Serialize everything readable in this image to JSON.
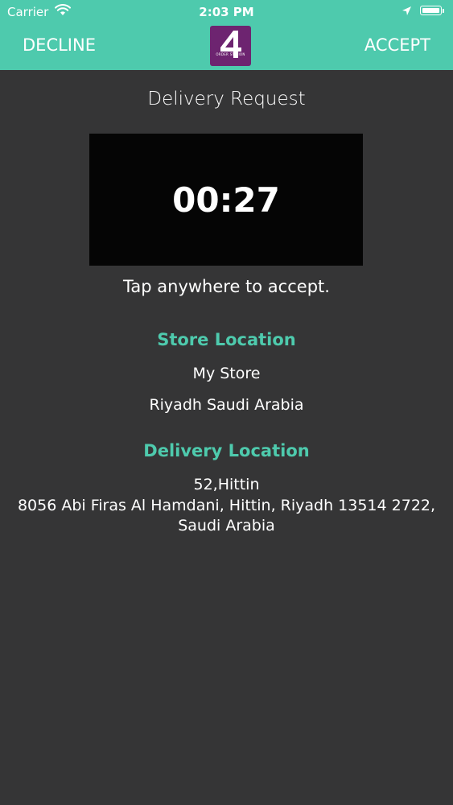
{
  "status_bar": {
    "carrier": "Carrier",
    "time": "2:03 PM",
    "wifi_icon": "wifi-icon",
    "location_icon": "location-arrow-icon",
    "battery_icon": "battery-icon",
    "battery_level": 1.0
  },
  "nav": {
    "decline_label": "DECLINE",
    "accept_label": "ACCEPT",
    "logo_text": "ORDER STATION",
    "logo_digit": "4"
  },
  "request": {
    "title": "Delivery Request",
    "timer": "00:27",
    "hint": "Tap anywhere to accept."
  },
  "store": {
    "heading": "Store  Location",
    "name": "My Store",
    "city": "Riyadh Saudi Arabia"
  },
  "delivery": {
    "heading": "Delivery Location",
    "line1": "52,Hittin",
    "line2": "8056 Abi Firas Al Hamdani,  Hittin,  Riyadh 13514 2722,",
    "line3": "Saudi Arabia"
  },
  "colors": {
    "accent": "#4ecaad",
    "background": "#353536",
    "timer_box": "#050505",
    "logo": "#6d2470"
  }
}
